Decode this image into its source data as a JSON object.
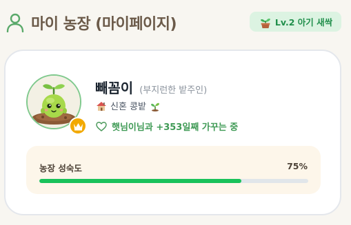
{
  "header": {
    "title": "마이 농장 (마이페이지)",
    "user_icon": "user-icon",
    "level_badge": {
      "icon": "potted-sprout-icon",
      "label": "Lv.2 아기 새싹"
    }
  },
  "profile": {
    "avatar": "sprout-character-avatar",
    "badge_icon": "crown-icon",
    "nickname": "빼꼼이",
    "title": "(부지런한 밭주인)",
    "farm": {
      "house_icon": "house-icon",
      "name": "신혼 콩밭",
      "sprout_icon": "seedling-icon"
    },
    "days": {
      "icon": "heart-icon",
      "text": "햇님이님과 +353일째 가꾸는 중"
    }
  },
  "progress": {
    "label": "농장 성숙도",
    "value_text": "75%",
    "fraction": 0.75
  },
  "colors": {
    "accent_green": "#19c25a",
    "title_brown": "#6b5a49",
    "badge_bg": "#dcf3e2",
    "crown_gold": "#f2a900"
  }
}
